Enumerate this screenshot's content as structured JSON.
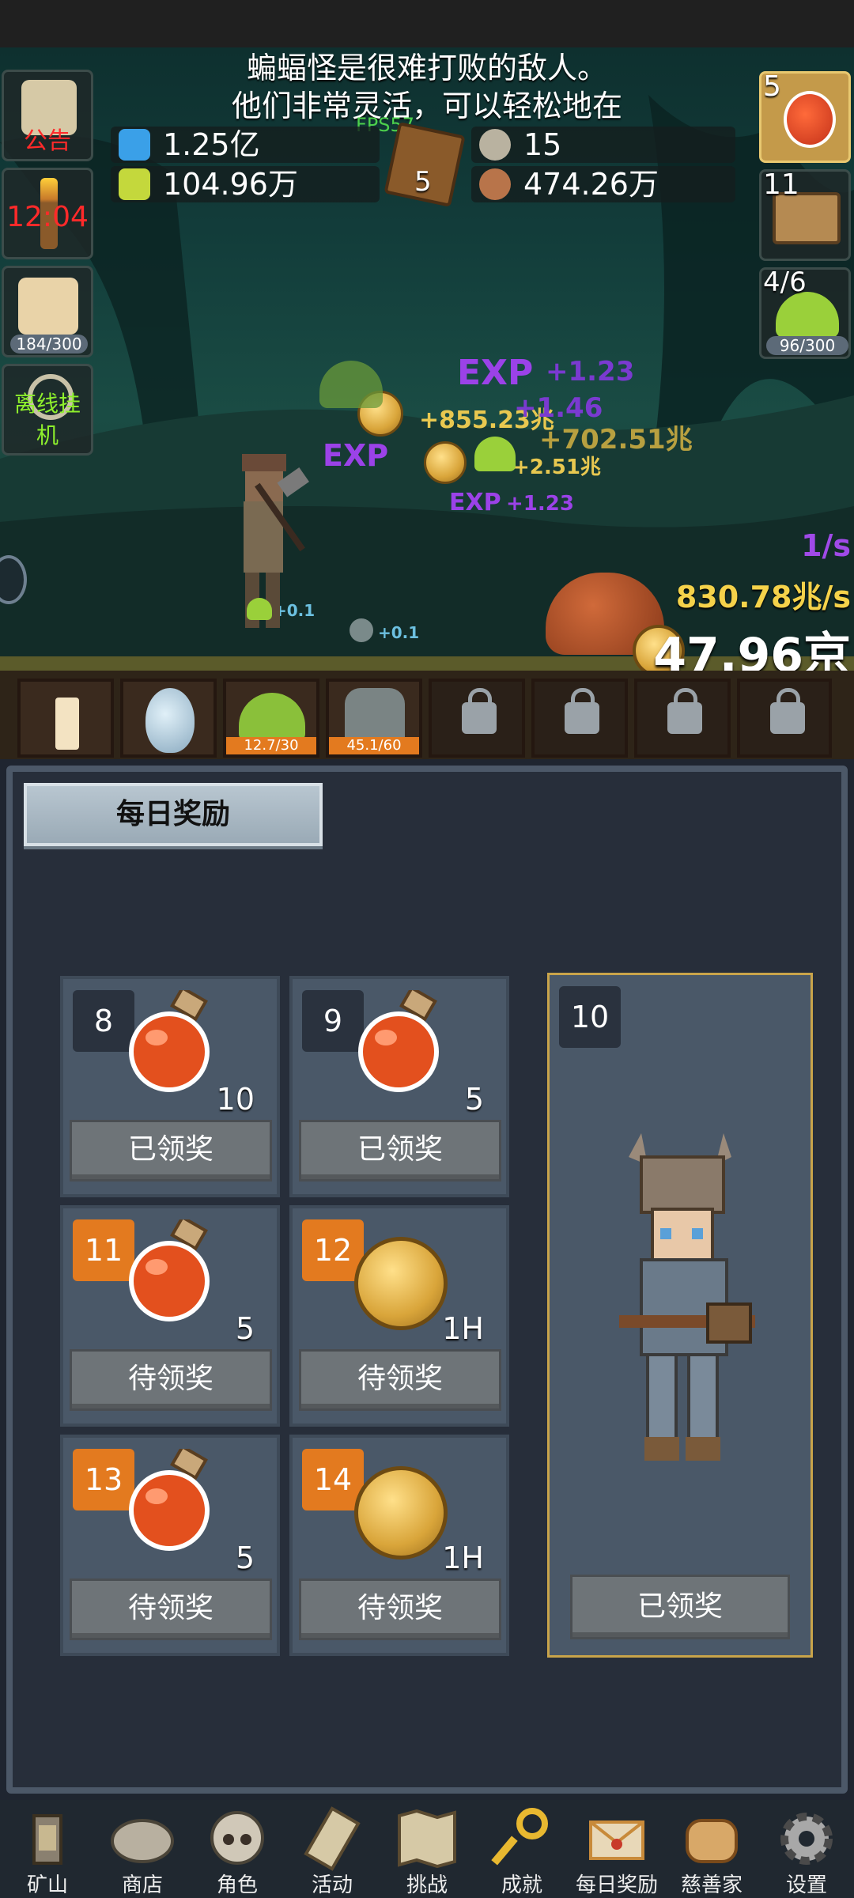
{
  "banner": {
    "line1": "蝙蝠怪是很难打败的敌人。",
    "line2": "他们非常灵活，可以轻松地在"
  },
  "fps": "FPS57",
  "resources": {
    "mana": "1.25亿",
    "elixir": "104.96万",
    "book_count": "5",
    "gems": "15",
    "meat": "474.26万"
  },
  "left_side": {
    "notice_label": "公告",
    "torch_timer": "12:04",
    "beer_progress": "184/300",
    "offline_label": "离线挂机"
  },
  "right_side": {
    "potion_count": "5",
    "chest_count": "11",
    "slime_count": "4/6",
    "slime_progress": "96/300"
  },
  "battle": {
    "rate_label": "1/s",
    "income_rate": "830.78兆/s",
    "gold_total": "47.96京",
    "floats": [
      "EXP",
      "+1.23",
      "+855.23兆",
      "+1.46",
      "+702.51兆",
      "EXP",
      "+2.51兆",
      "EXP",
      "+1.23",
      "+0.1",
      "+0.1"
    ]
  },
  "monster_slots": [
    {
      "name": "candle",
      "progress": ""
    },
    {
      "name": "egg",
      "progress": ""
    },
    {
      "name": "slime",
      "progress": "12.7/30"
    },
    {
      "name": "zombie",
      "progress": "45.1/60"
    },
    {
      "name": "locked-1",
      "progress": ""
    },
    {
      "name": "locked-2",
      "progress": ""
    },
    {
      "name": "locked-3",
      "progress": ""
    },
    {
      "name": "locked-4",
      "progress": ""
    }
  ],
  "panel": {
    "title": "每日奖励",
    "rewards": [
      {
        "day": "8",
        "item": "potion",
        "qty": "10",
        "status": "已领奖",
        "claimed": true
      },
      {
        "day": "9",
        "item": "potion",
        "qty": "5",
        "status": "已领奖",
        "claimed": true
      },
      {
        "day": "11",
        "item": "potion",
        "qty": "5",
        "status": "待领奖",
        "claimed": false
      },
      {
        "day": "12",
        "item": "coin",
        "qty": "1H",
        "status": "待领奖",
        "claimed": false
      },
      {
        "day": "13",
        "item": "potion",
        "qty": "5",
        "status": "待领奖",
        "claimed": false
      },
      {
        "day": "14",
        "item": "coin",
        "qty": "1H",
        "status": "待领奖",
        "claimed": false
      }
    ],
    "big_reward": {
      "day": "10",
      "status": "已领奖"
    }
  },
  "nav": [
    {
      "label": "矿山",
      "icon": "lantern-icon"
    },
    {
      "label": "商店",
      "icon": "shop-icon"
    },
    {
      "label": "角色",
      "icon": "skull-icon"
    },
    {
      "label": "活动",
      "icon": "scroll-icon"
    },
    {
      "label": "挑战",
      "icon": "map-icon"
    },
    {
      "label": "成就",
      "icon": "key-icon"
    },
    {
      "label": "每日奖励",
      "icon": "envelope-icon"
    },
    {
      "label": "慈善家",
      "icon": "bread-icon"
    },
    {
      "label": "设置",
      "icon": "gear-icon"
    }
  ],
  "colors": {
    "accent_orange": "#e37a1f",
    "gold_text": "#f5d24a",
    "exp_purple": "#9b42e8",
    "timer_red": "#ff2a2a",
    "offline_green": "#8ef02c"
  }
}
